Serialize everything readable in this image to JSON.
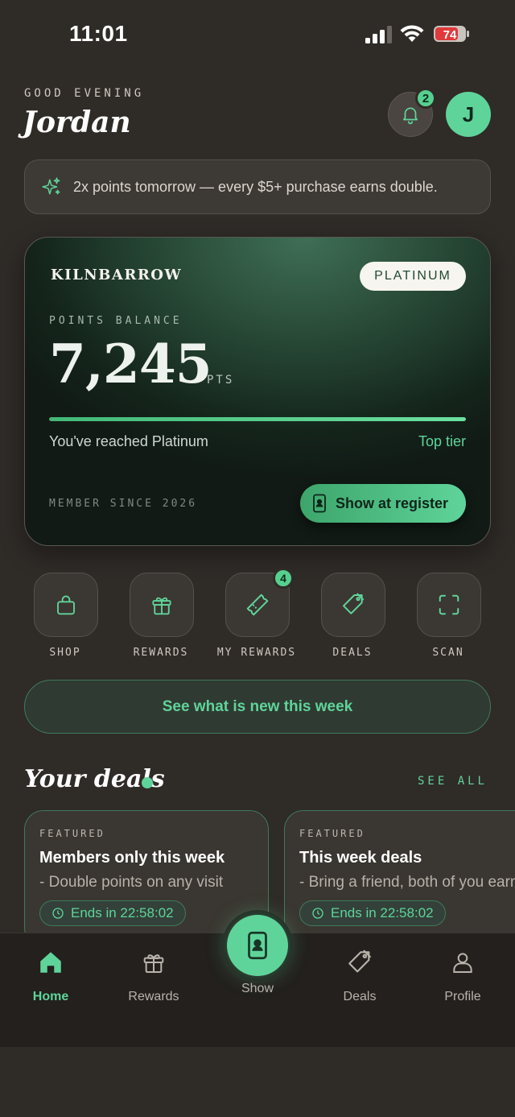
{
  "status_bar": {
    "time": "11:01",
    "battery": "74"
  },
  "header": {
    "greeting": "GOOD EVENING",
    "name": "Jordan",
    "notification_count": "2",
    "avatar_initial": "J"
  },
  "promo": {
    "text": "2x points tomorrow — every $5+ purchase earns double."
  },
  "card": {
    "brand": "KILNBARROW",
    "tier": "PLATINUM",
    "points_label": "POINTS BALANCE",
    "points": "7,245",
    "points_unit": "PTS",
    "progress": 1.0,
    "status_text": "You've reached Platinum",
    "status_right": "Top tier",
    "member_since": "MEMBER SINCE 2026",
    "show_button": "Show at register"
  },
  "quick_actions": [
    {
      "label": "SHOP",
      "icon": "bag-icon"
    },
    {
      "label": "REWARDS",
      "icon": "gift-icon"
    },
    {
      "label": "MY REWARDS",
      "icon": "ticket-icon",
      "badge": "4"
    },
    {
      "label": "DEALS",
      "icon": "tag-icon"
    },
    {
      "label": "SCAN",
      "icon": "scan-icon"
    }
  ],
  "week_button": "See what is new this week",
  "deals": {
    "title": "Your deals",
    "see_all": "SEE ALL",
    "items": [
      {
        "tag": "FEATURED",
        "title": "Members only this week",
        "desc": "- Double points on any visit",
        "timer": "Ends in 22:58:02"
      },
      {
        "tag": "FEATURED",
        "title": "This week deals",
        "desc": "- Bring a friend, both of you earn",
        "timer": "Ends in 22:58:02"
      }
    ]
  },
  "tabbar": {
    "home": "Home",
    "rewards": "Rewards",
    "show": "Show",
    "deals": "Deals",
    "profile": "Profile"
  },
  "colors": {
    "accent": "#5fd49a",
    "background": "#2f2b27",
    "card_dark": "#14241b"
  }
}
